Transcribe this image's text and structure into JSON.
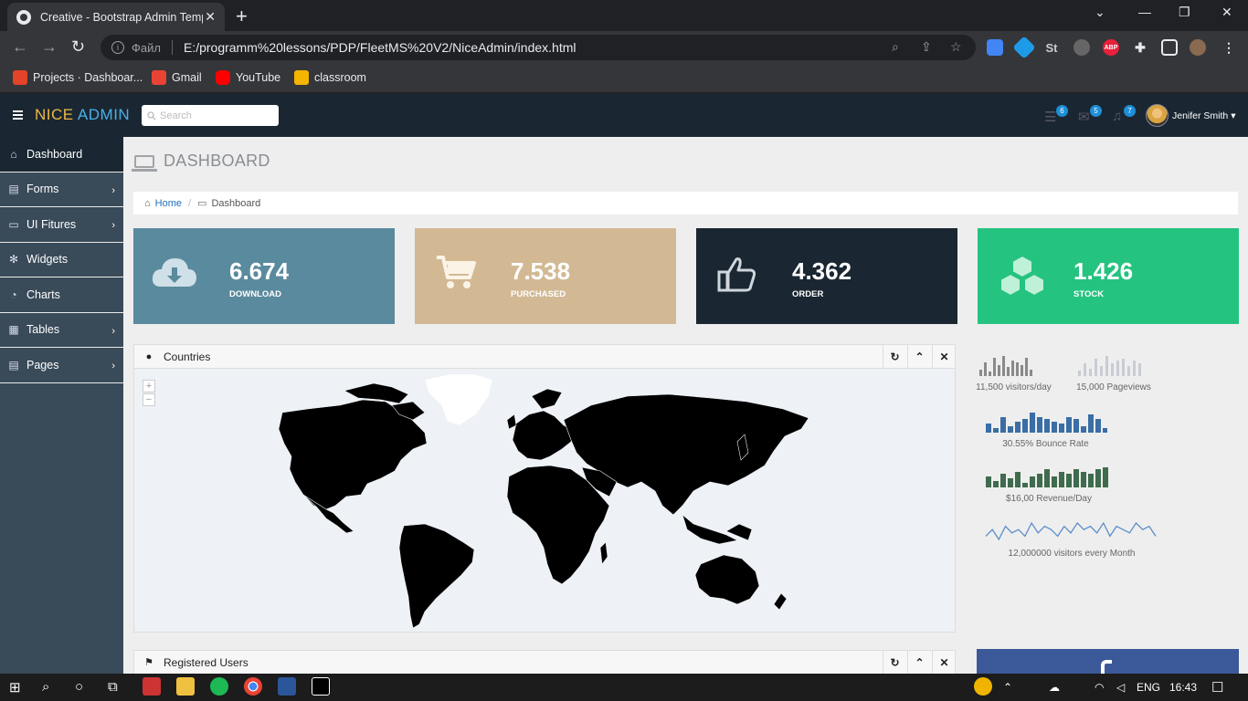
{
  "browser": {
    "tab_title": "Creative - Bootstrap Admin Template",
    "address_prefix": "Файл",
    "url": "E:/programm%20lessons/PDP/FleetMS%20V2/NiceAdmin/index.html",
    "bookmarks": [
      {
        "label": "Projects · Dashboar...",
        "icon": "gitlab-icon",
        "color": "#e24329"
      },
      {
        "label": "Gmail",
        "icon": "gmail-icon",
        "color": "#ea4335"
      },
      {
        "label": "YouTube",
        "icon": "youtube-icon",
        "color": "#ff0000"
      },
      {
        "label": "classroom",
        "icon": "classroom-icon",
        "color": "#f4b400"
      }
    ],
    "extensions": [
      "St",
      "ABP"
    ]
  },
  "header": {
    "brand_nice": "NICE",
    "brand_admin": "ADMIN",
    "search_placeholder": "Search",
    "badges": {
      "tasks": "6",
      "mail": "5",
      "notifications": "7"
    },
    "user_name": "Jenifer Smith"
  },
  "sidebar": {
    "items": [
      {
        "label": "Dashboard",
        "icon": "home-icon",
        "active": true,
        "chevron": ""
      },
      {
        "label": "Forms",
        "icon": "document-icon",
        "active": false,
        "chevron": "›"
      },
      {
        "label": "UI Fitures",
        "icon": "desktop-icon",
        "active": false,
        "chevron": "›"
      },
      {
        "label": "Widgets",
        "icon": "gear-icon",
        "active": false,
        "chevron": ""
      },
      {
        "label": "Charts",
        "icon": "pie-chart-icon",
        "active": false,
        "chevron": ""
      },
      {
        "label": "Tables",
        "icon": "table-icon",
        "active": false,
        "chevron": "›"
      },
      {
        "label": "Pages",
        "icon": "pages-icon",
        "active": false,
        "chevron": "›"
      }
    ]
  },
  "page": {
    "title": "DASHBOARD",
    "breadcrumb_home": "Home",
    "breadcrumb_current": "Dashboard"
  },
  "stats": [
    {
      "value": "6.674",
      "label": "DOWNLOAD",
      "color": "#5a8a9d",
      "icon": "cloud-download-icon"
    },
    {
      "value": "7.538",
      "label": "PURCHASED",
      "color": "#d2b994",
      "icon": "cart-icon"
    },
    {
      "value": "4.362",
      "label": "ORDER",
      "color": "#1a2732",
      "icon": "thumbs-up-icon"
    },
    {
      "value": "1.426",
      "label": "STOCK",
      "color": "#25c380",
      "icon": "cubes-icon"
    }
  ],
  "countries_panel": {
    "title": "Countries",
    "zoom_in": "+",
    "zoom_out": "−"
  },
  "users_panel": {
    "title": "Registered Users"
  },
  "sparklines": [
    {
      "label": "11,500 visitors/day",
      "values": [
        3,
        6,
        2,
        8,
        5,
        9,
        4,
        7,
        6,
        5,
        8,
        3
      ],
      "color": "#8a8a8a"
    },
    {
      "label": "15,000 Pageviews",
      "values": [
        2,
        5,
        3,
        7,
        4,
        8,
        5,
        6,
        7,
        4,
        6,
        5
      ],
      "color": "#c8ccd4"
    },
    {
      "label": "30.55% Bounce Rate",
      "values": [
        4,
        2,
        7,
        3,
        5,
        6,
        9,
        7,
        6,
        5,
        4,
        7,
        6,
        3,
        8,
        6,
        2
      ],
      "color": "#3a6ea5"
    },
    {
      "label": "$16,00 Revenue/Day",
      "values": [
        5,
        3,
        6,
        4,
        7,
        2,
        5,
        6,
        8,
        5,
        7,
        6,
        8,
        7,
        6,
        8,
        9
      ],
      "color": "#3f6b4e"
    },
    {
      "label": "12,000000 visitors every Month",
      "values": [
        4,
        6,
        3,
        7,
        5,
        6,
        4,
        8,
        5,
        7,
        6,
        4,
        7,
        5,
        8,
        6,
        7,
        5,
        8,
        4,
        7,
        6,
        5,
        8,
        6,
        7,
        4
      ],
      "color": "#5b8ec9"
    }
  ],
  "taskbar": {
    "language": "ENG",
    "time": "16:43"
  }
}
